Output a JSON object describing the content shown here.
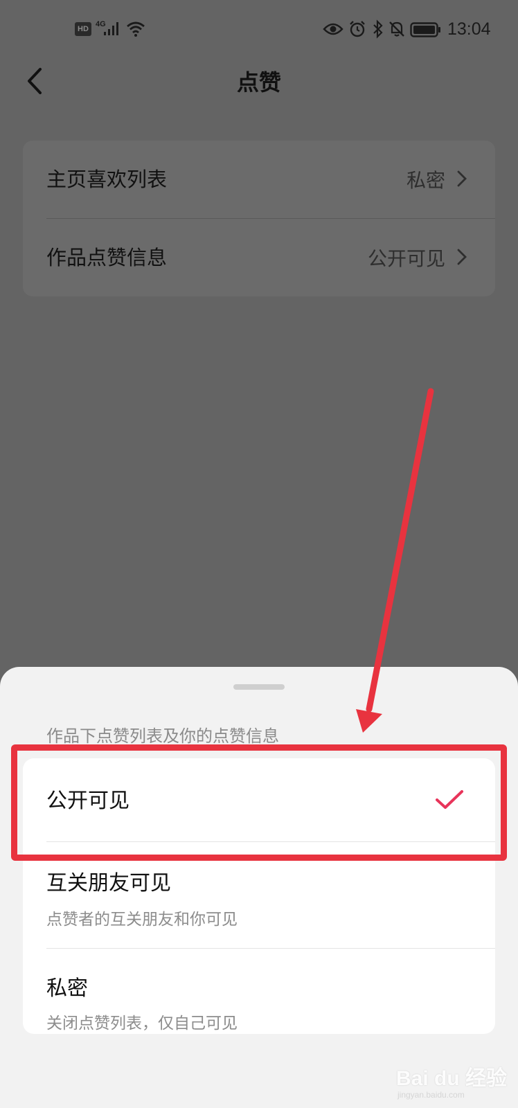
{
  "status_bar": {
    "hd": "HD",
    "network": "4G",
    "time": "13:04",
    "icons": [
      "signal-icon",
      "wifi-icon",
      "eye-icon",
      "alarm-icon",
      "bluetooth-icon",
      "mute-bell-icon",
      "battery-icon"
    ]
  },
  "header": {
    "title": "点赞",
    "back_icon": "chevron-left-icon"
  },
  "settings": [
    {
      "label": "主页喜欢列表",
      "value": "私密"
    },
    {
      "label": "作品点赞信息",
      "value": "公开可见"
    }
  ],
  "sheet": {
    "subtitle": "作品下点赞列表及你的点赞信息",
    "options": [
      {
        "label": "公开可见",
        "description": "",
        "selected": true
      },
      {
        "label": "互关朋友可见",
        "description": "点赞者的互关朋友和你可见",
        "selected": false
      },
      {
        "label": "私密",
        "description": "关闭点赞列表，仅自己可见",
        "selected": false
      }
    ]
  },
  "colors": {
    "overlay": "#646464",
    "sheet_background": "#f2f2f2",
    "check_accent": "#e8345a",
    "annotation_red": "#e8333f"
  },
  "watermark": {
    "brand": "Bai du 经验",
    "site": "jingyan.baidu.com"
  }
}
